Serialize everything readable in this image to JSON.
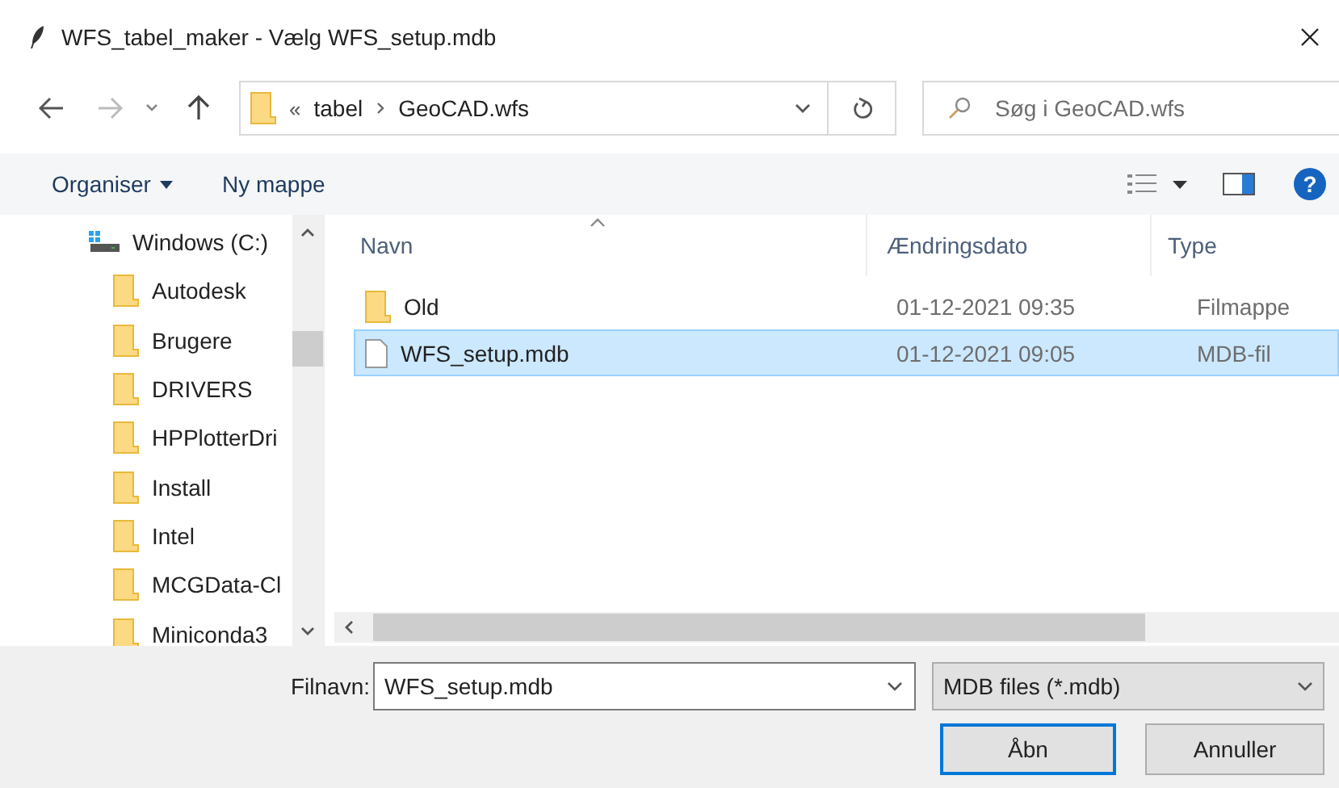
{
  "window": {
    "title": "WFS_tabel_maker - Vælg WFS_setup.mdb"
  },
  "address": {
    "overflow": "«",
    "segments": [
      "tabel",
      "GeoCAD.wfs"
    ]
  },
  "search": {
    "placeholder": "Søg i GeoCAD.wfs"
  },
  "toolbar": {
    "organize": "Organiser",
    "new_folder": "Ny mappe",
    "help": "?"
  },
  "sidebar": {
    "items": [
      {
        "label": "Windows (C:)",
        "kind": "drive",
        "children": [
          {
            "label": "Autodesk",
            "kind": "folder"
          },
          {
            "label": "Brugere",
            "kind": "folder"
          },
          {
            "label": "DRIVERS",
            "kind": "folder"
          },
          {
            "label": "HPPlotterDri",
            "kind": "folder"
          },
          {
            "label": "Install",
            "kind": "folder"
          },
          {
            "label": "Intel",
            "kind": "folder"
          },
          {
            "label": "MCGData-Cl",
            "kind": "folder"
          },
          {
            "label": "Miniconda3",
            "kind": "folder"
          }
        ]
      }
    ]
  },
  "columns": [
    {
      "label": "Navn",
      "sorted": true
    },
    {
      "label": "Ændringsdato",
      "sorted": false
    },
    {
      "label": "Type",
      "sorted": false
    }
  ],
  "files": [
    {
      "name": "Old",
      "date": "01-12-2021 09:35",
      "type": "Filmappe",
      "kind": "folder",
      "selected": false
    },
    {
      "name": "WFS_setup.mdb",
      "date": "01-12-2021 09:05",
      "type": "MDB-fil",
      "kind": "file",
      "selected": true
    }
  ],
  "filename": {
    "label": "Filnavn:",
    "value": "WFS_setup.mdb"
  },
  "filter": {
    "value": "MDB files (*.mdb)"
  },
  "buttons": [
    {
      "label": "Åbn",
      "kind": "primary"
    },
    {
      "label": "Annuller",
      "kind": "normal"
    }
  ]
}
